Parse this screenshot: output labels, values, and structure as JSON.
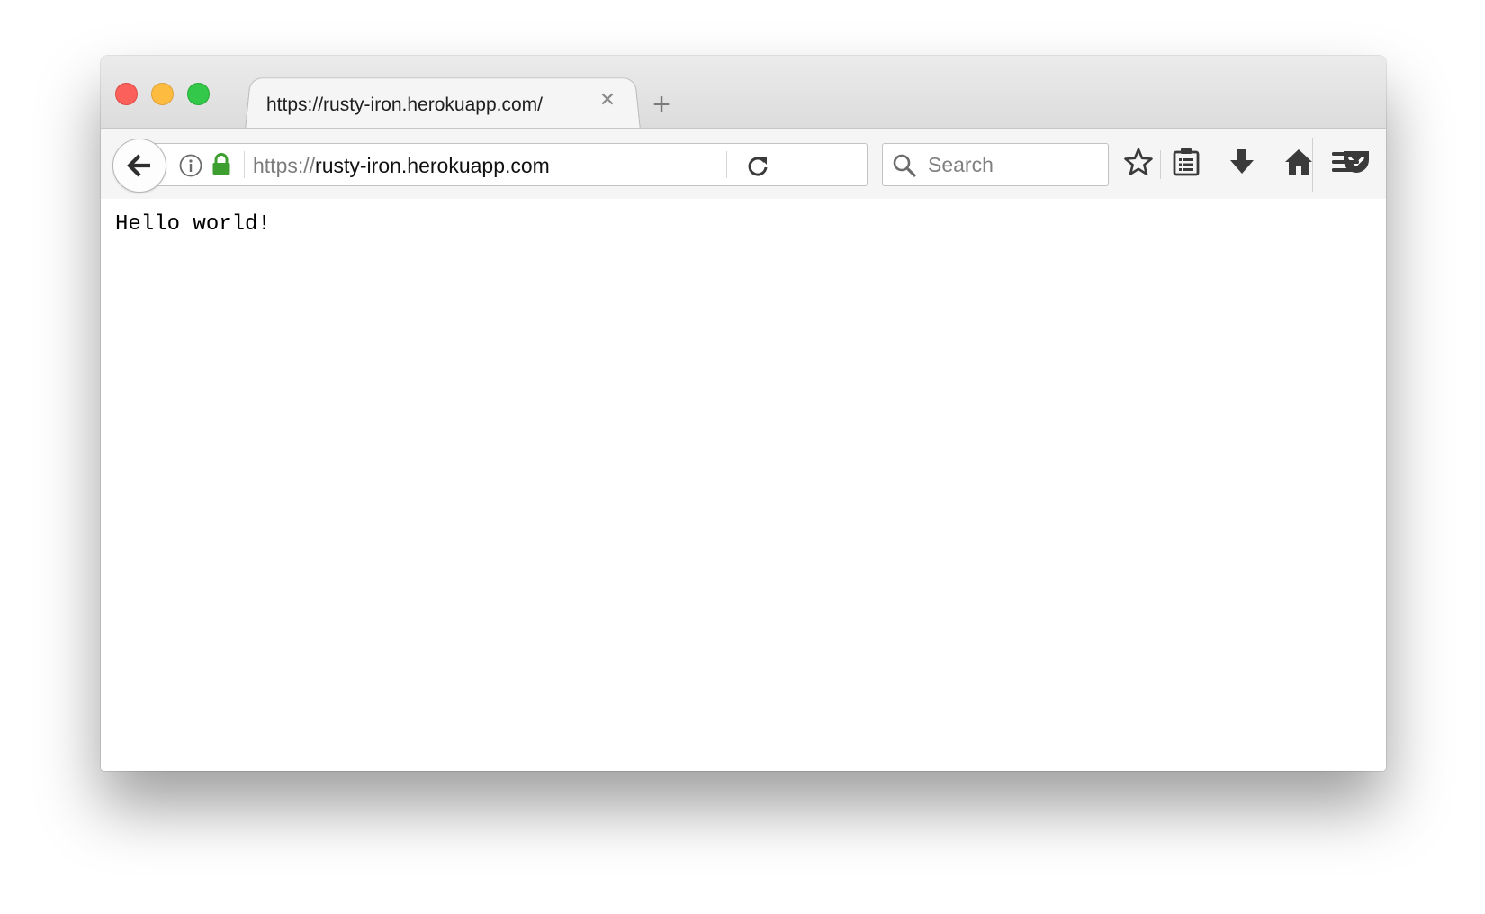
{
  "browser": {
    "tab": {
      "title": "https://rusty-iron.herokuapp.com/",
      "close_glyph": "✕"
    },
    "new_tab_glyph": "+",
    "address_bar": {
      "scheme": "https://",
      "host": "rusty-iron.herokuapp.com"
    },
    "search": {
      "placeholder": "Search"
    },
    "toolbar_icons": [
      "bookmark-star-icon",
      "reading-list-icon",
      "downloads-icon",
      "home-icon",
      "pocket-icon",
      "menu-icon"
    ],
    "colors": {
      "close": "#fc605b",
      "minimize": "#fdbc40",
      "maximize": "#34c84a",
      "lock": "#3c9f2f"
    }
  },
  "page": {
    "body_text": "Hello world!"
  }
}
